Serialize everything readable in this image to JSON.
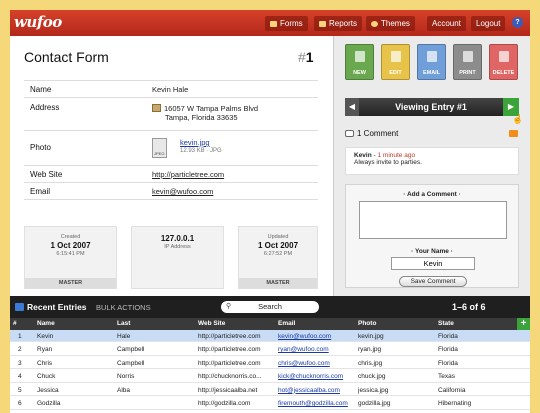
{
  "app": {
    "logo": "wufoo"
  },
  "nav": [
    {
      "label": "Forms",
      "icon": "forms-icon"
    },
    {
      "label": "Reports",
      "icon": "reports-icon"
    },
    {
      "label": "Themes",
      "icon": "themes-icon"
    },
    {
      "label": "Account"
    },
    {
      "label": "Logout"
    }
  ],
  "help": "?",
  "entry": {
    "form_title": "Contact Form",
    "number_hash": "#",
    "number": "1",
    "fields": [
      {
        "label": "Name",
        "value": "Kevin Hale"
      },
      {
        "label": "Address",
        "line1": "16057 W Tampa Palms Blvd",
        "line2": "Tampa, Florida 33635"
      },
      {
        "label": "Photo",
        "file": "kevin.jpg",
        "meta": "12.93 KB · JPG",
        "file_type": "JPEG"
      },
      {
        "label": "Web Site",
        "value": "http://particletree.com"
      },
      {
        "label": "Email",
        "value": "kevin@wufoo.com"
      }
    ],
    "cards": [
      {
        "kicker": "Created",
        "value": "1 Oct 2007",
        "time": "6:15:41 PM",
        "footer": "MASTER"
      },
      {
        "kicker": "",
        "value": "127.0.0.1",
        "time": "IP Address",
        "footer": ""
      },
      {
        "kicker": "Updated",
        "value": "1 Oct 2007",
        "time": "6:27:52 PM",
        "footer": "MASTER"
      }
    ]
  },
  "actions": [
    {
      "label": "NEW",
      "color": "#6aa84f"
    },
    {
      "label": "EDIT",
      "color": "#e8c34a"
    },
    {
      "label": "EMAIL",
      "color": "#6f9ed8"
    },
    {
      "label": "PRINT",
      "color": "#8c8c8c"
    },
    {
      "label": "DELETE",
      "color": "#e06666"
    }
  ],
  "viewing": {
    "prev": "◀",
    "label": "Viewing Entry #1",
    "next": "▶"
  },
  "comments": {
    "count_label": "1 Comment",
    "items": [
      {
        "author": "Kevin",
        "sep": " - ",
        "time": "1 minute ago",
        "text": "Always invite to parties."
      }
    ],
    "add_heading": "· Add a Comment ·",
    "name_heading": "· Your Name ·",
    "name_value": "Kevin",
    "save_label": "Save Comment"
  },
  "list": {
    "title": "Recent Entries",
    "bulk": "BULK ACTIONS",
    "search_placeholder": "Search",
    "pager": "1–6 of 6",
    "add": "+",
    "columns": [
      "#",
      "Name",
      "Last",
      "Web Site",
      "Email",
      "Photo",
      "State"
    ],
    "rows": [
      [
        "1",
        "Kevin",
        "Hale",
        "http://particletree.com",
        "kevin@wufoo.com",
        "kevin.jpg",
        "Florida"
      ],
      [
        "2",
        "Ryan",
        "Campbell",
        "http://particletree.com",
        "ryan@wufoo.com",
        "ryan.jpg",
        "Florida"
      ],
      [
        "3",
        "Chris",
        "Campbell",
        "http://particletree.com",
        "chris@wufoo.com",
        "chris.jpg",
        "Florida"
      ],
      [
        "4",
        "Chuck",
        "Norris",
        "http://chucknorris.co...",
        "kick@chucknorris.com",
        "chuck.jpg",
        "Texas"
      ],
      [
        "5",
        "Jessica",
        "Alba",
        "http://jessicaalba.net",
        "hot@jessicaalba.com",
        "jessica.jpg",
        "California"
      ],
      [
        "6",
        "Godzilla",
        "",
        "http://godzilla.com",
        "firemouth@godzilla.com",
        "godzilla.jpg",
        "Hibernating"
      ]
    ]
  }
}
